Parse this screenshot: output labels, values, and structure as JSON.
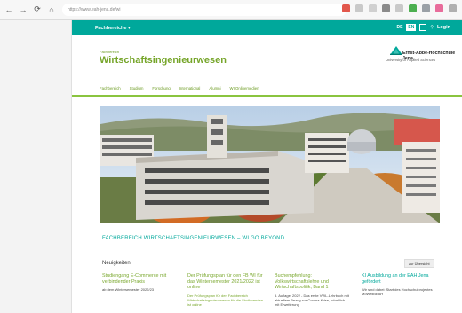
{
  "browser": {
    "url": "https://www.eah-jena.de/wi"
  },
  "topbar": {
    "menu_label": "Fachbereiche ▾",
    "lang_de": "DE",
    "lang_en": "EN",
    "login": "Login",
    "color": "#00a89b"
  },
  "header": {
    "fb_label": "Fachbereich",
    "title": "Wirtschaftsingenieurwesen",
    "logo_name": "Ernst-Abbe-Hochschule Jena",
    "logo_sub": "University of Applied Sciences"
  },
  "nav": {
    "items": [
      "Fachbereich",
      "Studium",
      "Forschung",
      "International",
      "Alumni",
      "WI Onlinemedien"
    ]
  },
  "slogan": "FACHBEREICH WIRTSCHAFTSINGENIEURWESEN – WI GO BEYOND",
  "news": {
    "heading": "Neuigkeiten",
    "all_button": "zur Übersicht",
    "items": [
      {
        "title": "Studiengang E-Commerce mit verbindender Praxis",
        "sub": "ab dem Wintersemester 2022/23"
      },
      {
        "title": "Der Prüfungsplan für den FB WI für das Wintersemester 2021/2022 ist online",
        "sub": "Der Prüfungsplan für den Fachbereich Wirtschaftsingenieurwesen für die Studierenden ist online"
      },
      {
        "title": "Buchempfehlung: Volkswirtschaftslehre und Wirtschaftspolitik, Band 1",
        "sub": "5. Auflage, 2022 - Das erste VWL-Lehrbuch mit aktuellem Bezug zur Corona-Krise, Inhaltlich mit Erweiterung"
      },
      {
        "title": "KI Ausbildung an der EAH Jena gefördert",
        "sub": "Wir sind dabei: Start des Hochschulprojektes MoWellBEAH"
      }
    ]
  }
}
